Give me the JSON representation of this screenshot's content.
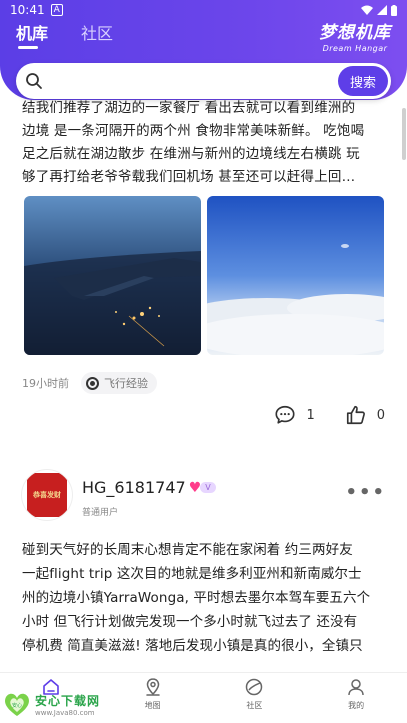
{
  "statusbar": {
    "time": "10:41",
    "notif": "A"
  },
  "header": {
    "tabs": [
      {
        "label": "机库",
        "active": true
      },
      {
        "label": "社区",
        "active": false
      }
    ],
    "brand_cn": "梦想机库",
    "brand_en": "Dream Hangar",
    "accent": "#5e3ee8"
  },
  "search": {
    "value": "",
    "placeholder": "",
    "button_label": "搜索",
    "icon": "search-icon"
  },
  "post1": {
    "text_lines": [
      "结我们推荐了湖边的一家餐厅 看出去就可以看到维洲的",
      "边境 是一条河隔开的两个州 食物非常美味新鲜。 吃饱喝",
      "足之后就在湖边散步 在维洲与新州的边境线左右横跳 玩",
      "够了再打给老爷爷载我们回机场 甚至还可以赶得上回…"
    ],
    "time": "19小时前",
    "tag": "飞行经验",
    "comments": "1",
    "likes": "0"
  },
  "post2": {
    "avatar_text": "恭喜发财",
    "username": "HG_6181747",
    "vip_badge": "V",
    "role": "普通用户",
    "text_lines": [
      "碰到天气好的长周末心想肯定不能在家闲着 约三两好友",
      "一起flight trip 这次目的地就是维多利亚州和新南威尔士",
      "州的边境小镇YarraWonga, 平时想去墨尔本驾车要五六个",
      "小时 但飞行计划做完发现一个多小时就飞过去了 还没有",
      "停机费 简直美滋滋! 落地后发现小镇是真的很小，全镇只"
    ]
  },
  "bottom_nav": [
    {
      "label": "",
      "icon": "home-icon",
      "active": true
    },
    {
      "label": "地图",
      "icon": "map-pin-icon",
      "active": false
    },
    {
      "label": "社区",
      "icon": "community-icon",
      "active": false
    },
    {
      "label": "我的",
      "icon": "profile-icon",
      "active": false
    }
  ],
  "watermark": {
    "cn": "安心下载网",
    "en": "www.Java80.com",
    "logo": "安心"
  }
}
